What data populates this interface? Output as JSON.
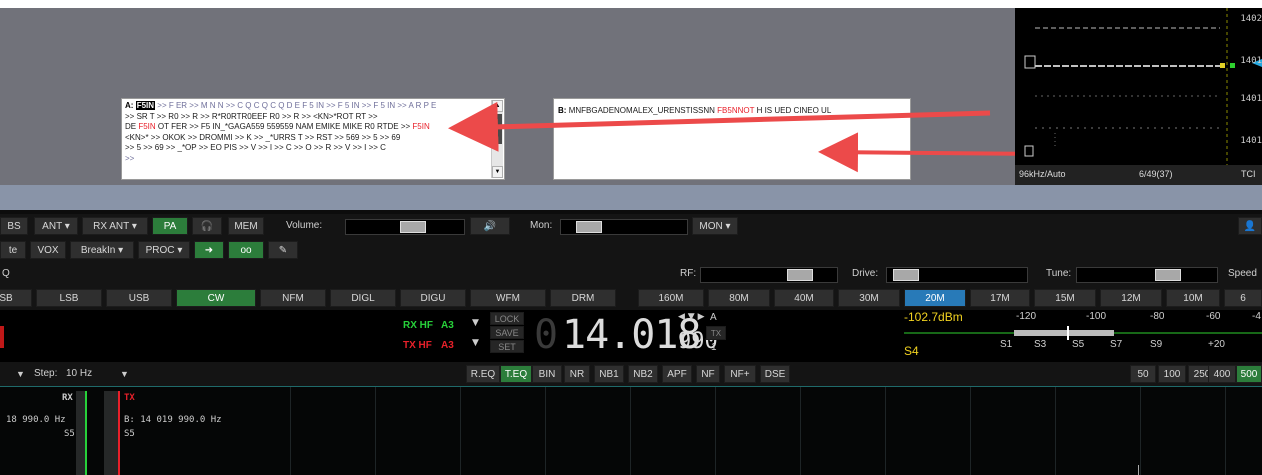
{
  "colors": {
    "accent_green": "#2c7d3b",
    "accent_blue": "#287ab8",
    "rx_green": "#27d13a",
    "tx_red": "#e8202a",
    "meter_yellow": "#f2d320"
  },
  "window_a": {
    "label": "A:",
    "callsign": "F5IN",
    "line1_rest": ">> F ER >> M N N >> C Q C Q C Q D E F 5 IN >> F 5 IN >> F 5 IN >> A R P E",
    "line2": ">> SR T >> R0 >> R >> R*R0RTR0EEF R0 >> R >> <KN>*ROT RT >>",
    "line3_a": "DE ",
    "line3_call": "F5IN",
    "line3_b": " OT FER >> F5 IN_*GAGA559 559559 NAM EMIKE MIKE R0 RTDE >> ",
    "line3_call2": "F5IN",
    "line4": "<KN>* >> OKOK >> DROMMI >> K >> _*URRS T >> RST >> 569 >> 5 >> 69",
    "line5": ">> 5 >> 69 >> _*OP >> EO PIS >> V >> I >> C >> O >> R >> V >> I >> C",
    "line6": ">>"
  },
  "window_b": {
    "label": "B:",
    "text_a": "MNFBGADENOMALEX_URENSTISSNN ",
    "text_call": "FB5NNOT",
    "text_b": " H IS UED CINEO UL"
  },
  "panadapter": {
    "freq_ticks": [
      "1402",
      "1401",
      "1401",
      "1401"
    ],
    "span": "96kHz/Auto",
    "counter": "6/49(37)",
    "tci": "TCI"
  },
  "row1": {
    "bs": "BS",
    "ant": "ANT",
    "rx_ant": "RX ANT",
    "pa": "PA",
    "mem": "MEM",
    "volume_label": "Volume:",
    "volume_level": 0.6,
    "mon_label": "Mon:",
    "mon_level": 0.15,
    "mon_btn": "MON"
  },
  "row2": {
    "mute": "te",
    "vox": "VOX",
    "breakin": "BreakIn",
    "proc": "PROC"
  },
  "row3": {
    "q": "Q",
    "rf_label": "RF:",
    "rf_level": 0.8,
    "drive_label": "Drive:",
    "drive_level": 0.05,
    "tune_label": "Tune:",
    "tune_level": 0.7,
    "speed_label": "Speed"
  },
  "modes": [
    "SB",
    "LSB",
    "USB",
    "CW",
    "NFM",
    "DIGL",
    "DIGU",
    "WFM",
    "DRM"
  ],
  "mode_selected": "CW",
  "bands": [
    "160M",
    "80M",
    "40M",
    "30M",
    "20M",
    "17M",
    "15M",
    "12M",
    "10M",
    "6"
  ],
  "band_selected": "20M",
  "vfo": {
    "rx_label": "RX HF",
    "rx_ant": "A3",
    "tx_label": "TX HF",
    "tx_ant": "A3",
    "lock": "LOCK",
    "save": "SAVE",
    "set": "SET",
    "freq_main": "14.018",
    "freq_small": "990",
    "vfo_letter": "A",
    "tx_badge": "TX",
    "rx_num": "1"
  },
  "meter": {
    "dbm": "-102.7dBm",
    "s_reading": "S4",
    "scale_top": [
      "-120",
      "-100",
      "-80",
      "-60",
      "-4"
    ],
    "scale_bottom": [
      "S1",
      "S3",
      "S5",
      "S7",
      "S9",
      "+20"
    ]
  },
  "row5": {
    "step_label": "Step:",
    "step_value": "10 Hz"
  },
  "dsp": [
    "R.EQ",
    "T.EQ",
    "BIN",
    "NR",
    "NB1",
    "NB2",
    "APF",
    "NF",
    "NF+",
    "DSE"
  ],
  "dsp_selected": "T.EQ",
  "filters": [
    "50",
    "100",
    "250",
    "400",
    "500"
  ],
  "filter_selected": "500",
  "spectrum": {
    "rx_label": "RX",
    "tx_label": "TX",
    "rx_freq": "18 990.0 Hz",
    "rx_s": "S5",
    "tx_freq": "B: 14 019 990.0 Hz",
    "tx_s": "S5"
  }
}
